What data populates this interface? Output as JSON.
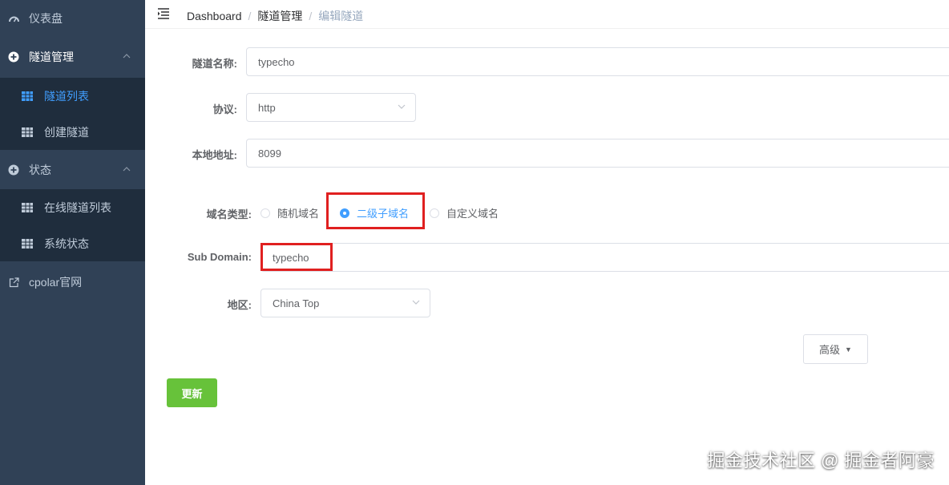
{
  "sidebar": {
    "items": [
      {
        "label": "仪表盘",
        "icon": "dashboard-icon"
      },
      {
        "label": "隧道管理",
        "icon": "plus-circle-icon",
        "children": [
          {
            "label": "隧道列表",
            "icon": "grid-icon",
            "active": true
          },
          {
            "label": "创建隧道",
            "icon": "grid-icon"
          }
        ]
      },
      {
        "label": "状态",
        "icon": "plus-circle-icon",
        "children": [
          {
            "label": "在线隧道列表",
            "icon": "grid-icon"
          },
          {
            "label": "系统状态",
            "icon": "grid-icon"
          }
        ]
      },
      {
        "label": "cpolar官网",
        "icon": "external-link-icon"
      }
    ]
  },
  "header": {
    "breadcrumb": [
      "Dashboard",
      "隧道管理",
      "编辑隧道"
    ]
  },
  "form": {
    "tunnel_name": {
      "label": "隧道名称:",
      "value": "typecho"
    },
    "protocol": {
      "label": "协议:",
      "value": "http"
    },
    "local_address": {
      "label": "本地地址:",
      "value": "8099"
    },
    "domain_type": {
      "label": "域名类型:",
      "options": [
        "随机域名",
        "二级子域名",
        "自定义域名"
      ],
      "selected": "二级子域名"
    },
    "sub_domain": {
      "label": "Sub Domain:",
      "value": "typecho"
    },
    "region": {
      "label": "地区:",
      "value": "China Top"
    }
  },
  "buttons": {
    "advanced": "高级",
    "update": "更新"
  },
  "watermark": "掘金技术社区 @ 掘金者阿豪",
  "colors": {
    "sidebar_bg": "#304156",
    "submenu_bg": "#1f2d3d",
    "accent": "#409eff",
    "success": "#67c23a",
    "highlight": "#e02020"
  }
}
